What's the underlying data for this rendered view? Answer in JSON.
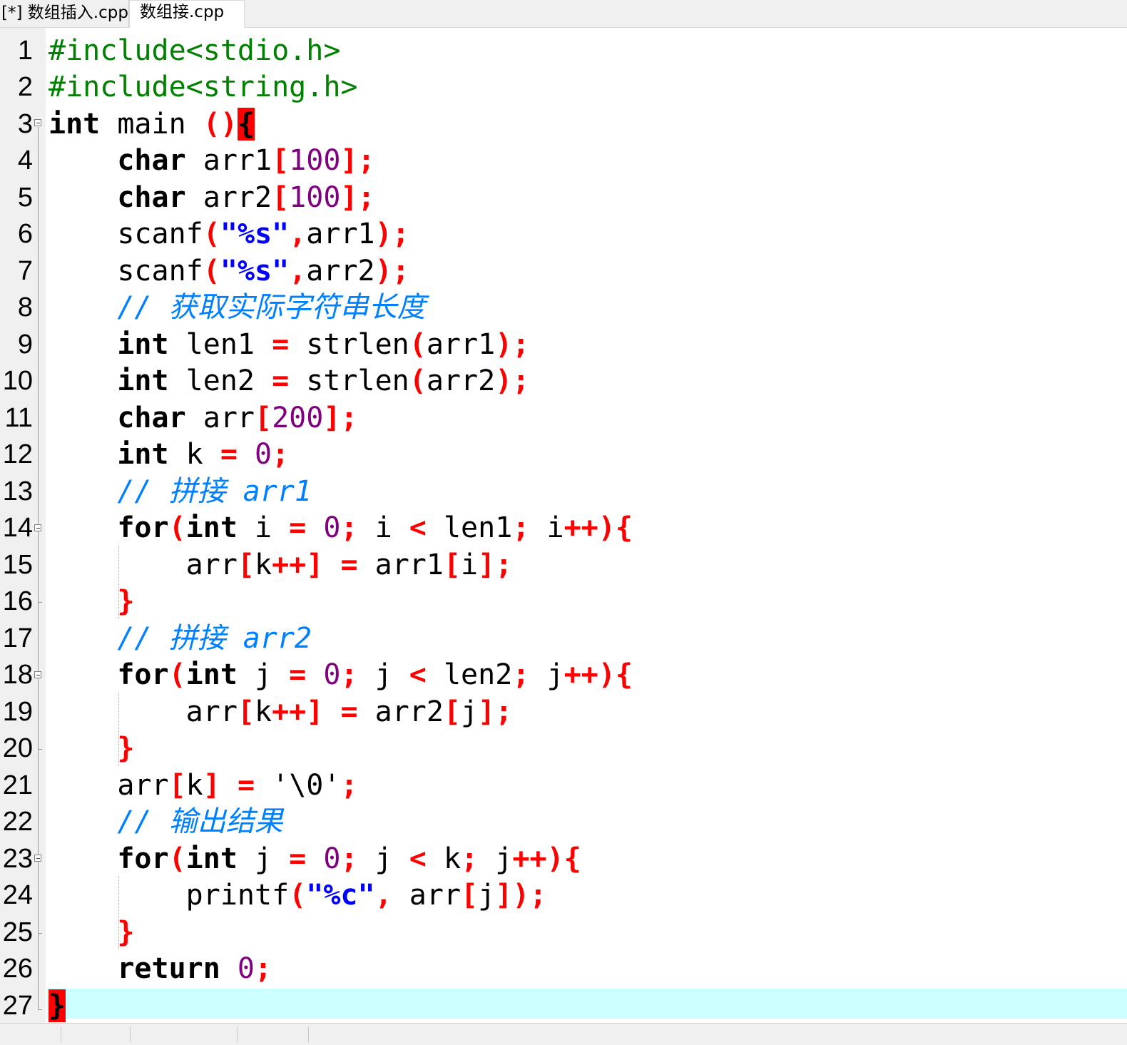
{
  "tabs": [
    {
      "label": "[*] 数组插入.cpp",
      "active": false
    },
    {
      "label": "数组接.cpp",
      "active": true
    }
  ],
  "line_numbers": [
    "1",
    "2",
    "3",
    "4",
    "5",
    "6",
    "7",
    "8",
    "9",
    "10",
    "11",
    "12",
    "13",
    "14",
    "15",
    "16",
    "17",
    "18",
    "19",
    "20",
    "21",
    "22",
    "23",
    "24",
    "25",
    "26",
    "27"
  ],
  "code": {
    "l1": {
      "directive": "#include<stdio.h>"
    },
    "l2": {
      "directive": "#include<string.h>"
    },
    "l3": {
      "type": "int",
      "name": " main ",
      "parens": "()",
      "brace": "{"
    },
    "l4": {
      "type": "char",
      "id": " arr1",
      "lb": "[",
      "num": "100",
      "rb": "];"
    },
    "l5": {
      "type": "char",
      "id": " arr2",
      "lb": "[",
      "num": "100",
      "rb": "];"
    },
    "l6": {
      "fn": "scanf",
      "lp": "(",
      "q1": "\"",
      "fmt": "%s",
      "q2": "\"",
      "comma": ",",
      "arg": "arr1",
      "end": ");"
    },
    "l7": {
      "fn": "scanf",
      "lp": "(",
      "q1": "\"",
      "fmt": "%s",
      "q2": "\"",
      "comma": ",",
      "arg": "arr2",
      "end": ");"
    },
    "l8": {
      "comment": "// 获取实际字符串长度"
    },
    "l9": {
      "type": "int",
      "id": " len1 ",
      "eq": "=",
      "fn": " strlen",
      "lp": "(",
      "arg": "arr1",
      "end": ");"
    },
    "l10": {
      "type": "int",
      "id": " len2 ",
      "eq": "=",
      "fn": " strlen",
      "lp": "(",
      "arg": "arr2",
      "end": ");"
    },
    "l11": {
      "type": "char",
      "id": " arr",
      "lb": "[",
      "num": "200",
      "rb": "];"
    },
    "l12": {
      "type": "int",
      "id": " k ",
      "eq": "=",
      "num": "0",
      "end": ";"
    },
    "l13": {
      "comment": "// 拼接 arr1"
    },
    "l14": {
      "kw": "for",
      "lp": "(",
      "type": "int",
      "v1": " i ",
      "eq": "=",
      "num": "0",
      "semi1": ";",
      "v2": " i ",
      "lt": "<",
      "v3": " len1",
      "semi2": ";",
      "v4": " i",
      "inc": "++){"
    },
    "l15": {
      "a": "arr",
      "lb": "[",
      "k": "k",
      "inc": "++]",
      "eq": "=",
      "b": " arr1",
      "lb2": "[",
      "i": "i",
      "end": "];"
    },
    "l16": {
      "brace": "}"
    },
    "l17": {
      "comment": "// 拼接 arr2"
    },
    "l18": {
      "kw": "for",
      "lp": "(",
      "type": "int",
      "v1": " j ",
      "eq": "=",
      "num": "0",
      "semi1": ";",
      "v2": " j ",
      "lt": "<",
      "v3": " len2",
      "semi2": ";",
      "v4": " j",
      "inc": "++){"
    },
    "l19": {
      "a": "arr",
      "lb": "[",
      "k": "k",
      "inc": "++]",
      "eq": "=",
      "b": " arr2",
      "lb2": "[",
      "i": "j",
      "end": "];"
    },
    "l20": {
      "brace": "}"
    },
    "l21": {
      "a": "arr",
      "lb": "[",
      "k": "k",
      "rb": "]",
      "eq": "=",
      "ch": " '\\0'",
      "end": ";"
    },
    "l22": {
      "comment": "// 输出结果"
    },
    "l23": {
      "kw": "for",
      "lp": "(",
      "type": "int",
      "v1": " j ",
      "eq": "=",
      "num": "0",
      "semi1": ";",
      "v2": " j ",
      "lt": "<",
      "v3": " k",
      "semi2": ";",
      "v4": " j",
      "inc": "++){"
    },
    "l24": {
      "fn": "printf",
      "lp": "(",
      "q1": "\"",
      "fmt": "%c",
      "q2": "\"",
      "comma": ",",
      "arg": " arr",
      "lb": "[",
      "i": "j",
      "end": "]);"
    },
    "l25": {
      "brace": "}"
    },
    "l26": {
      "kw": "return",
      "num": "0",
      "end": ";"
    },
    "l27": {
      "brace": "}"
    }
  },
  "colors": {
    "preprocessor": "#008000",
    "operator": "#ff0000",
    "number": "#800080",
    "string": "#0000ff",
    "comment": "#0080ff",
    "current_line": "#ccffff",
    "brace_match": "#ff0000"
  },
  "icons": [
    "fold-minus-icon"
  ]
}
